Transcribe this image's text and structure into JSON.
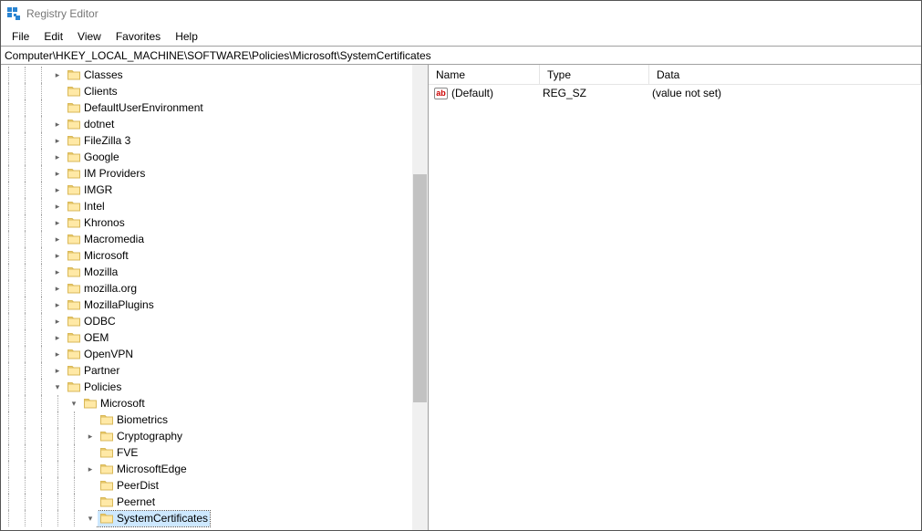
{
  "window": {
    "title": "Registry Editor"
  },
  "menu": {
    "file": "File",
    "edit": "Edit",
    "view": "View",
    "favorites": "Favorites",
    "help": "Help"
  },
  "path": "Computer\\HKEY_LOCAL_MACHINE\\SOFTWARE\\Policies\\Microsoft\\SystemCertificates",
  "columns": {
    "name": "Name",
    "type": "Type",
    "data": "Data"
  },
  "values": [
    {
      "icon": "ab",
      "name": "(Default)",
      "type": "REG_SZ",
      "data": "(value not set)"
    }
  ],
  "tree": [
    {
      "depth": 3,
      "exp": "closed",
      "label": "Classes"
    },
    {
      "depth": 3,
      "exp": "none",
      "label": "Clients"
    },
    {
      "depth": 3,
      "exp": "none",
      "label": "DefaultUserEnvironment"
    },
    {
      "depth": 3,
      "exp": "closed",
      "label": "dotnet"
    },
    {
      "depth": 3,
      "exp": "closed",
      "label": "FileZilla 3"
    },
    {
      "depth": 3,
      "exp": "closed",
      "label": "Google"
    },
    {
      "depth": 3,
      "exp": "closed",
      "label": "IM Providers"
    },
    {
      "depth": 3,
      "exp": "closed",
      "label": "IMGR"
    },
    {
      "depth": 3,
      "exp": "closed",
      "label": "Intel"
    },
    {
      "depth": 3,
      "exp": "closed",
      "label": "Khronos"
    },
    {
      "depth": 3,
      "exp": "closed",
      "label": "Macromedia"
    },
    {
      "depth": 3,
      "exp": "closed",
      "label": "Microsoft"
    },
    {
      "depth": 3,
      "exp": "closed",
      "label": "Mozilla"
    },
    {
      "depth": 3,
      "exp": "closed",
      "label": "mozilla.org"
    },
    {
      "depth": 3,
      "exp": "closed",
      "label": "MozillaPlugins"
    },
    {
      "depth": 3,
      "exp": "closed",
      "label": "ODBC"
    },
    {
      "depth": 3,
      "exp": "closed",
      "label": "OEM"
    },
    {
      "depth": 3,
      "exp": "closed",
      "label": "OpenVPN"
    },
    {
      "depth": 3,
      "exp": "closed",
      "label": "Partner"
    },
    {
      "depth": 3,
      "exp": "open",
      "label": "Policies"
    },
    {
      "depth": 4,
      "exp": "open",
      "label": "Microsoft"
    },
    {
      "depth": 5,
      "exp": "none",
      "label": "Biometrics"
    },
    {
      "depth": 5,
      "exp": "closed",
      "label": "Cryptography"
    },
    {
      "depth": 5,
      "exp": "none",
      "label": "FVE"
    },
    {
      "depth": 5,
      "exp": "closed",
      "label": "MicrosoftEdge"
    },
    {
      "depth": 5,
      "exp": "none",
      "label": "PeerDist"
    },
    {
      "depth": 5,
      "exp": "none",
      "label": "Peernet"
    },
    {
      "depth": 5,
      "exp": "open",
      "label": "SystemCertificates",
      "selected": true
    }
  ],
  "glyphs": {
    "closed": "▸",
    "open": "▾"
  }
}
